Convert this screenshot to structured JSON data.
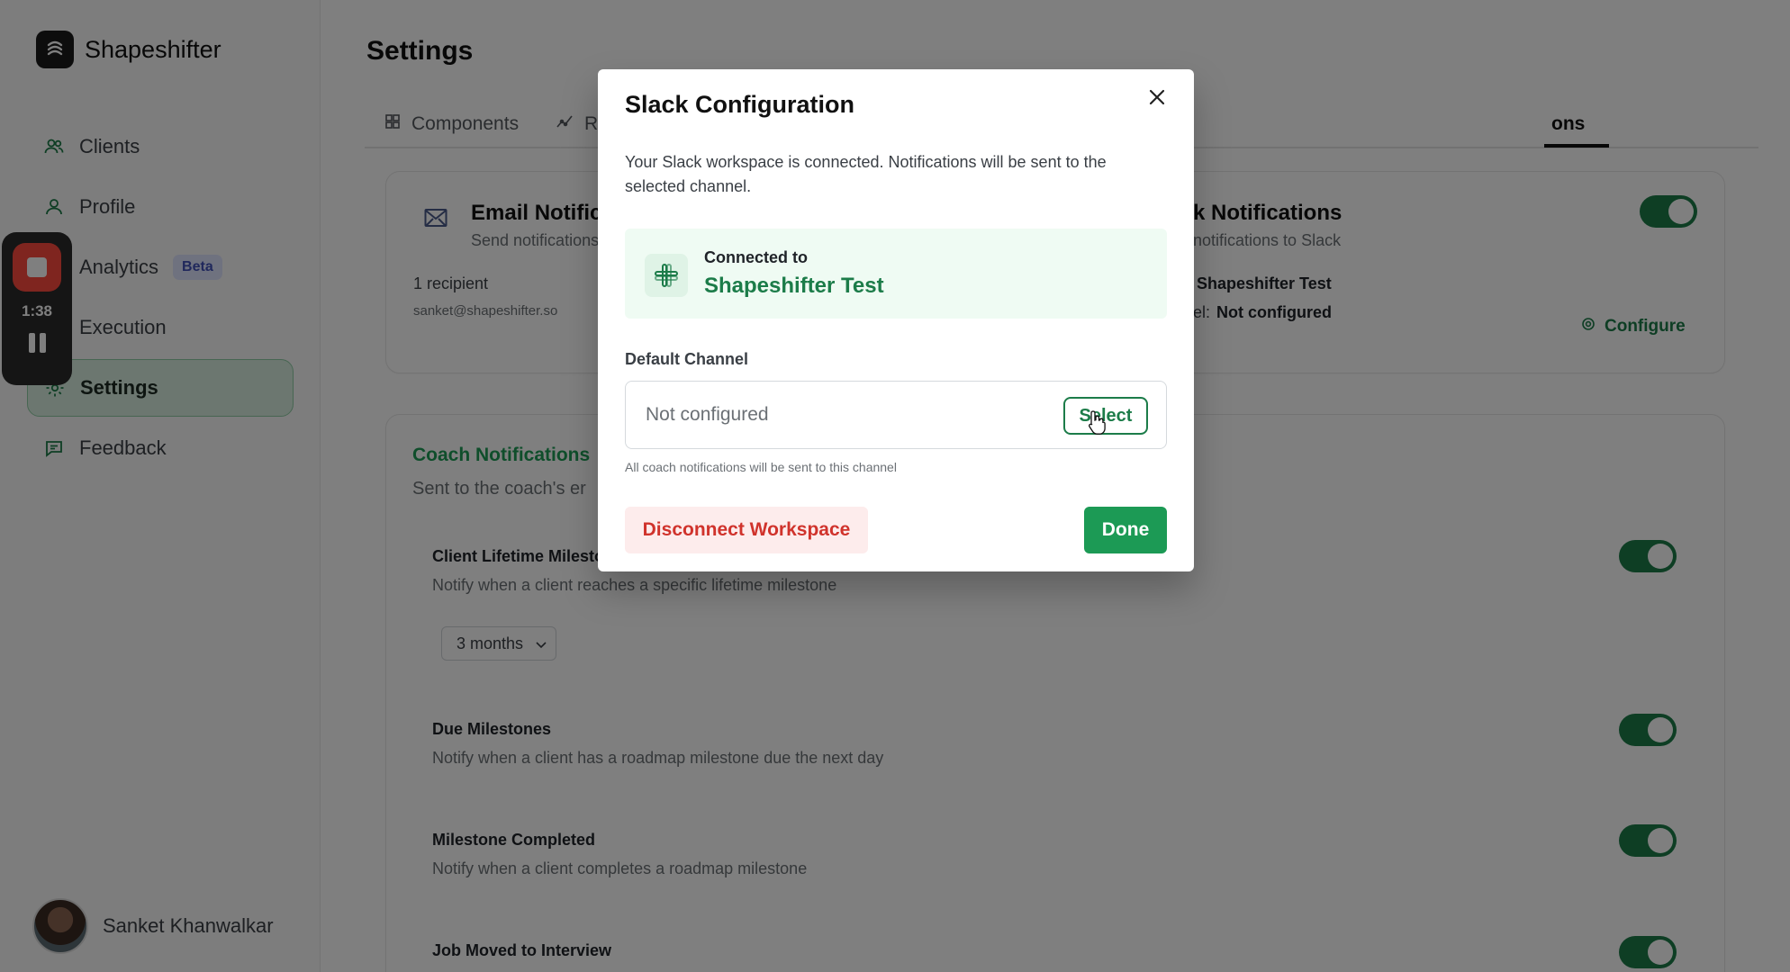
{
  "app": {
    "name": "Shapeshifter"
  },
  "sidebar": {
    "items": [
      {
        "label": "Clients",
        "icon": "users-icon"
      },
      {
        "label": "Profile",
        "icon": "user-icon"
      },
      {
        "label": "Analytics",
        "icon": "analytics-icon",
        "badge": "Beta"
      },
      {
        "label": "Execution",
        "icon": "execution-icon"
      },
      {
        "label": "Settings",
        "icon": "gear-icon",
        "active": true
      },
      {
        "label": "Feedback",
        "icon": "message-icon"
      }
    ],
    "user": {
      "name": "Sanket Khanwalkar"
    }
  },
  "recorder": {
    "time": "1:38"
  },
  "page": {
    "title": "Settings",
    "tabs": [
      {
        "label": "Components"
      },
      {
        "label": "R"
      },
      {
        "label": "ons"
      }
    ]
  },
  "email_card": {
    "title": "Email Notific",
    "subtitle": "Send notifications",
    "recipients": "1 recipient",
    "email": "sanket@shapeshifter.so"
  },
  "slack_card": {
    "title": "k Notifications",
    "subtitle": "notifications to Slack",
    "workspace": "Shapeshifter Test",
    "channel_prefix": "el:",
    "channel_value": "Not configured",
    "configure_label": "Configure"
  },
  "coach": {
    "title": "Coach Notifications",
    "subtitle": "Sent to the coach's er",
    "rows": [
      {
        "title": "Client Lifetime Milesto",
        "desc": "Notify when a client reaches a specific lifetime milestone"
      },
      {
        "title": "Due Milestones",
        "desc": "Notify when a client has a roadmap milestone due the next day"
      },
      {
        "title": "Milestone Completed",
        "desc": "Notify when a client completes a roadmap milestone"
      },
      {
        "title": "Job Moved to Interview",
        "desc": ""
      }
    ],
    "lifetime_select": "3 months"
  },
  "modal": {
    "title": "Slack Configuration",
    "description": "Your Slack workspace is connected. Notifications will be sent to the selected channel.",
    "connected_label": "Connected to",
    "workspace_name": "Shapeshifter Test",
    "field_label": "Default Channel",
    "field_value": "Not configured",
    "select_label": "Select",
    "hint": "All coach notifications will be sent to this channel",
    "disconnect_label": "Disconnect Workspace",
    "done_label": "Done"
  },
  "colors": {
    "brand_green": "#1c7c49",
    "done_green": "#1c9a55",
    "danger_red": "#d0332c",
    "record_red": "#ff4b3e"
  }
}
